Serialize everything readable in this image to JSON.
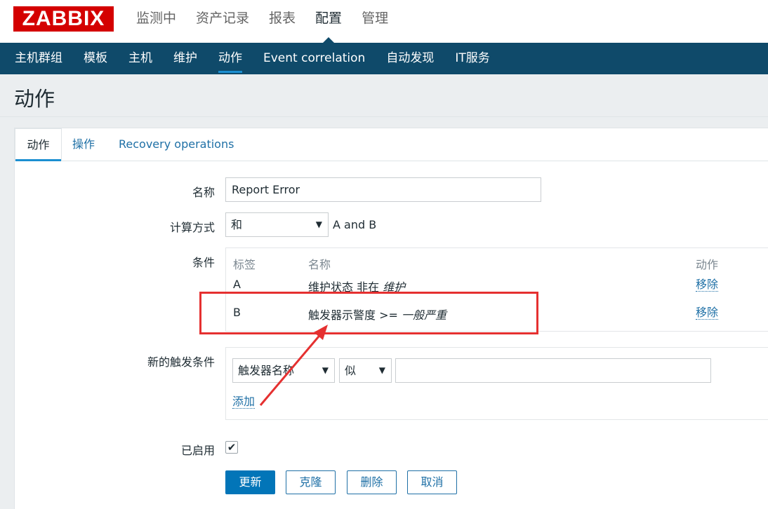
{
  "header": {
    "logo": "ZABBIX",
    "main_nav": [
      {
        "label": "监测中"
      },
      {
        "label": "资产记录"
      },
      {
        "label": "报表"
      },
      {
        "label": "配置"
      },
      {
        "label": "管理"
      }
    ],
    "active_main": "配置"
  },
  "sub_nav": [
    {
      "label": "主机群组"
    },
    {
      "label": "模板"
    },
    {
      "label": "主机"
    },
    {
      "label": "维护"
    },
    {
      "label": "动作"
    },
    {
      "label": "Event correlation"
    },
    {
      "label": "自动发现"
    },
    {
      "label": "IT服务"
    }
  ],
  "page_title": "动作",
  "tabs": [
    {
      "label": "动作"
    },
    {
      "label": "操作"
    },
    {
      "label": "Recovery operations"
    }
  ],
  "form": {
    "name_label": "名称",
    "name_value": "Report Error",
    "calc_label": "计算方式",
    "calc_value": "和",
    "calc_expression": "A and B",
    "conditions_label": "条件",
    "conditions": {
      "headers": {
        "label": "标签",
        "name": "名称",
        "action": "动作"
      },
      "rows": [
        {
          "label": "A",
          "text": "维护状态 非在 ",
          "value": "维护",
          "action": "移除"
        },
        {
          "label": "B",
          "text": "触发器示警度 >= ",
          "value": "一般严重",
          "action": "移除"
        }
      ]
    },
    "new_condition_label": "新的触发条件",
    "new_condition": {
      "type_value": "触发器名称",
      "operator_value": "似",
      "value": "",
      "add_label": "添加"
    },
    "enabled_label": "已启用",
    "enabled": true
  },
  "buttons": {
    "update": "更新",
    "clone": "克隆",
    "delete": "删除",
    "cancel": "取消"
  },
  "colors": {
    "brand": "#d40000",
    "nav_bg": "#0f4a6a",
    "accent": "#1b8fd1",
    "link": "#1f70a6",
    "annotation": "#e53030"
  }
}
